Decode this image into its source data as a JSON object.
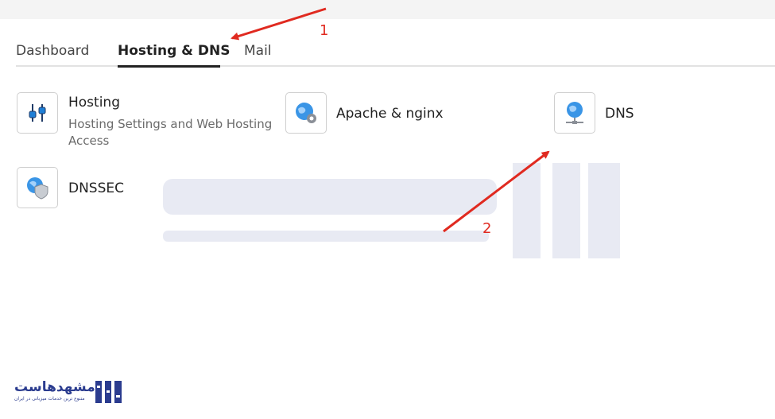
{
  "tabs": [
    {
      "label": "Dashboard",
      "active": false
    },
    {
      "label": "Hosting & DNS",
      "active": true
    },
    {
      "label": "Mail",
      "active": false
    }
  ],
  "items": {
    "hosting": {
      "title": "Hosting",
      "description": "Hosting Settings and Web Hosting Access",
      "icon": "sliders-icon"
    },
    "apache": {
      "title": "Apache & nginx",
      "icon": "globe-gear-icon"
    },
    "dns": {
      "title": "DNS",
      "icon": "globe-network-icon"
    },
    "dnssec": {
      "title": "DNSSEC",
      "icon": "globe-shield-icon"
    }
  },
  "annotations": {
    "first": "1",
    "second": "2"
  },
  "logo": {
    "name": "مشهدهاست",
    "tagline": "متنوع ترین خدمات میزبانی در ایران"
  },
  "colors": {
    "annotation": "#e02a20",
    "brand": "#2b3c8f",
    "icon_blue": "#1f7fd6"
  }
}
